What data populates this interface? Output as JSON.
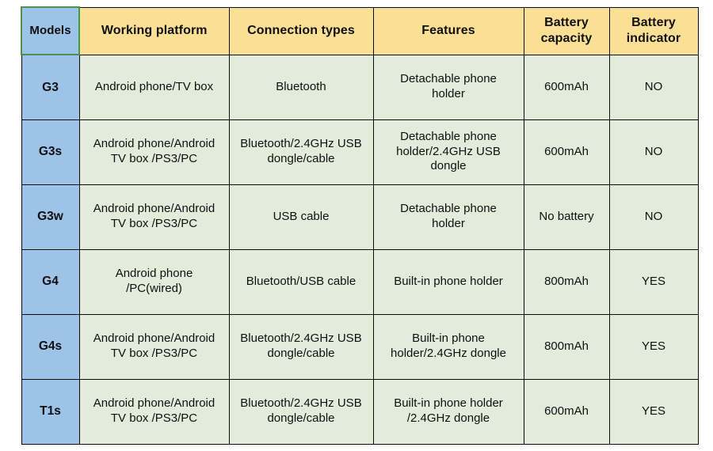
{
  "table": {
    "columns": [
      {
        "key": "models",
        "label": "Models"
      },
      {
        "key": "platform",
        "label": "Working platform"
      },
      {
        "key": "connection",
        "label": "Connection types"
      },
      {
        "key": "features",
        "label": "Features"
      },
      {
        "key": "capacity",
        "label": "Battery\ncapacity"
      },
      {
        "key": "indicator",
        "label": "Battery\nindicator"
      }
    ],
    "rows": [
      {
        "models": "G3",
        "platform": "Android phone/TV box",
        "connection": "Bluetooth",
        "features": "Detachable phone\nholder",
        "capacity": "600mAh",
        "indicator": "NO"
      },
      {
        "models": "G3s",
        "platform": "Android phone/Android\nTV box /PS3/PC",
        "connection": "Bluetooth/2.4GHz USB\ndongle/cable",
        "features": "Detachable phone\nholder/2.4GHz USB\ndongle",
        "capacity": "600mAh",
        "indicator": "NO"
      },
      {
        "models": "G3w",
        "platform": "Android phone/Android\nTV box /PS3/PC",
        "connection": "USB cable",
        "features": "Detachable phone\nholder",
        "capacity": "No battery",
        "indicator": "NO"
      },
      {
        "models": "G4",
        "platform": "Android phone\n/PC(wired)",
        "connection": "Bluetooth/USB cable",
        "features": "Built-in phone holder",
        "capacity": "800mAh",
        "indicator": "YES"
      },
      {
        "models": "G4s",
        "platform": "Android phone/Android\nTV box /PS3/PC",
        "connection": "Bluetooth/2.4GHz USB\ndongle/cable",
        "features": "Built-in phone\nholder/2.4GHz dongle",
        "capacity": "800mAh",
        "indicator": "YES"
      },
      {
        "models": "T1s",
        "platform": "Android phone/Android\nTV box /PS3/PC",
        "connection": "Bluetooth/2.4GHz USB\ndongle/cable",
        "features": "Built-in phone holder\n/2.4GHz dongle",
        "capacity": "600mAh",
        "indicator": "YES"
      }
    ]
  },
  "colors": {
    "header_background": "#fbdf95",
    "model_background": "#9dc3e8",
    "data_background": "#e3ecda",
    "border": "#0a0a0a",
    "selected_cell_outline": "#4a9648",
    "page_background": "#ffffff"
  }
}
